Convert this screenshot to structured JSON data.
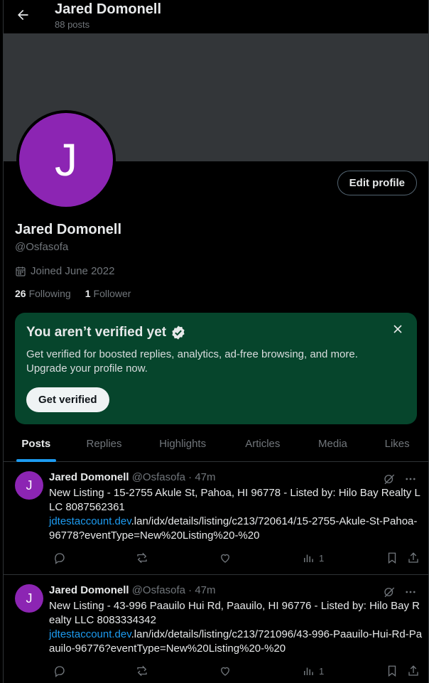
{
  "header": {
    "name": "Jared Domonell",
    "post_count": "88 posts"
  },
  "profile": {
    "avatar_letter": "J",
    "name": "Jared Domonell",
    "handle": "@Osfasofa",
    "joined": "Joined June 2022",
    "following_count": "26",
    "following_label": "Following",
    "followers_count": "1",
    "followers_label": "Follower",
    "edit_label": "Edit profile"
  },
  "verify": {
    "title": "You aren’t verified yet",
    "text": "Get verified for boosted replies, analytics, ad-free browsing, and more. Upgrade your profile now.",
    "button": "Get verified"
  },
  "tabs": [
    {
      "label": "Posts",
      "active": true
    },
    {
      "label": "Replies"
    },
    {
      "label": "Highlights"
    },
    {
      "label": "Articles"
    },
    {
      "label": "Media"
    },
    {
      "label": "Likes"
    }
  ],
  "posts": [
    {
      "avatar": "J",
      "name": "Jared Domonell",
      "handle": "@Osfasofa",
      "sep": " · ",
      "time": "47m",
      "text": "New Listing - 15-2755 Akule St, Pahoa, HI 96778 - Listed by: Hilo Bay Realty LLC 8087562361",
      "link_domain": "jdtestaccount.dev",
      "link_rest": ".lan/idx/details/listing/c213/720614/15-2755-Akule-St-Pahoa-96778?eventType=New%20Listing%20-%20",
      "views": "1"
    },
    {
      "avatar": "J",
      "name": "Jared Domonell",
      "handle": "@Osfasofa",
      "sep": " · ",
      "time": "47m",
      "text": "New Listing - 43-996 Paauilo Hui Rd, Paauilo, HI 96776 - Listed by: Hilo Bay Realty LLC 8083334342",
      "link_domain": "jdtestaccount.dev",
      "link_rest": ".lan/idx/details/listing/c213/721096/43-996-Paauilo-Hui-Rd-Paauilo-96776?eventType=New%20Listing%20-%20",
      "views": "1"
    }
  ],
  "colors": {
    "accent": "#1d9bf0",
    "avatar": "#8c25b3",
    "verify_bg": "#06452c",
    "banner": "#333639"
  }
}
